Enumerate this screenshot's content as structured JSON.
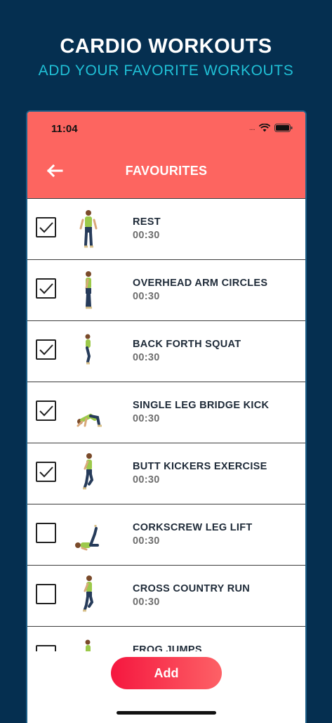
{
  "promo": {
    "title": "CARDIO WORKOUTS",
    "subtitle": "ADD YOUR FAVORITE WORKOUTS"
  },
  "status_bar": {
    "time": "11:04",
    "signal": "....",
    "icons": [
      "wifi-icon",
      "battery-icon"
    ]
  },
  "header": {
    "title": "FAVOURITES",
    "back_icon": "arrow-left-icon"
  },
  "exercises": [
    {
      "name": "REST",
      "duration": "00:30",
      "checked": true,
      "pose": "standing"
    },
    {
      "name": "OVERHEAD ARM CIRCLES",
      "duration": "00:30",
      "checked": true,
      "pose": "side"
    },
    {
      "name": "BACK FORTH SQUAT",
      "duration": "00:30",
      "checked": true,
      "pose": "squat"
    },
    {
      "name": "SINGLE LEG BRIDGE KICK",
      "duration": "00:30",
      "checked": true,
      "pose": "bridge"
    },
    {
      "name": "BUTT KICKERS EXERCISE",
      "duration": "00:30",
      "checked": true,
      "pose": "run"
    },
    {
      "name": "CORKSCREW LEG LIFT",
      "duration": "00:30",
      "checked": false,
      "pose": "lying"
    },
    {
      "name": "CROSS COUNTRY RUN",
      "duration": "00:30",
      "checked": false,
      "pose": "run"
    },
    {
      "name": "FROG JUMPS",
      "duration": "00:30",
      "checked": false,
      "pose": "squat"
    }
  ],
  "actions": {
    "add_label": "Add"
  },
  "colors": {
    "background": "#052f50",
    "accent": "#fd6560",
    "subtitle": "#20c0d6",
    "button_start": "#f5173f",
    "button_end": "#fd6166"
  }
}
